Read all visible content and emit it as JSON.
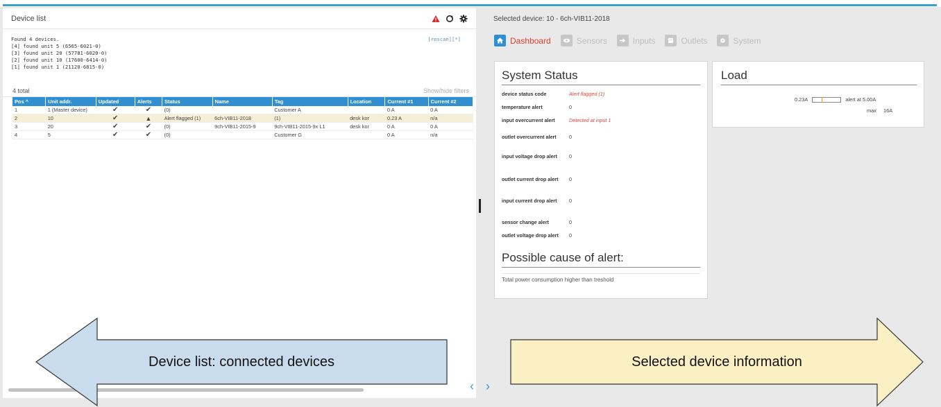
{
  "colors": {
    "accent_blue": "#2f8fd0",
    "alert_red": "#e0443a",
    "highlight_row": "#f6efd8",
    "arrow_left_fill": "#c9dced",
    "arrow_right_fill": "#fbefc4"
  },
  "left_panel": {
    "title": "Device list",
    "icons": [
      "alert-icon",
      "refresh-icon",
      "settings-icon"
    ],
    "console_lines": [
      "Found 4 devices.",
      "[4] found unit 5 (6565-6021-0)",
      "[3] found unit 20 (57781-6020-0)",
      "[2] found unit 10 (17600-6414-0)",
      "[1] found unit 1 (21120-6815-0)"
    ],
    "rescan_label": "[rescan][*]",
    "total_label": "4 total",
    "filters_label": "Show/hide filters",
    "table": {
      "columns": [
        "Pos ^",
        "Unit addr.",
        "Updated",
        "Alerts",
        "Status",
        "Name",
        "Tag",
        "Location",
        "Current #1",
        "Current #2"
      ],
      "rows": [
        {
          "pos": "1",
          "unit": "1 (Master device)",
          "updated": "✔",
          "alert": "✔",
          "status": "(0)",
          "name": "",
          "tag": "Customer A",
          "location": "",
          "c1": "0 A",
          "c2": "0 A"
        },
        {
          "pos": "2",
          "unit": "10",
          "updated": "✔",
          "alert": "▲",
          "status": "Alert flagged (1)",
          "name": "6ch-VIB11-2018",
          "tag": "(1)",
          "location": "desk kor",
          "c1": "0.23 A",
          "c2": "n/a"
        },
        {
          "pos": "3",
          "unit": "20",
          "updated": "✔",
          "alert": "✔",
          "status": "(0)",
          "name": "9ch-VIB11-2015-9",
          "tag": "9ch-VIB11-2015-9x L1",
          "location": "desk kor",
          "c1": "0 A",
          "c2": "0 A"
        },
        {
          "pos": "4",
          "unit": "5",
          "updated": "✔",
          "alert": "✔",
          "status": "(0)",
          "name": "",
          "tag": "Customer G",
          "location": "",
          "c1": "0 A",
          "c2": "n/a"
        }
      ]
    }
  },
  "nav_arrows": "‹ ›",
  "right_panel": {
    "selected_label": "Selected device: 10 - 6ch-VIB11-2018",
    "tabs": [
      {
        "label": "Dashboard",
        "icon": "home-icon",
        "active": true
      },
      {
        "label": "Sensors",
        "icon": "eye-icon",
        "active": false
      },
      {
        "label": "Inputs",
        "icon": "sign-in-icon",
        "active": false
      },
      {
        "label": "Outlets",
        "icon": "outlet-icon",
        "active": false
      },
      {
        "label": "System",
        "icon": "gear-icon",
        "active": false
      }
    ],
    "status": {
      "title": "System Status",
      "rows": [
        {
          "key": "device status code",
          "value": "Alert flagged (1)",
          "warn": true
        },
        {
          "key": "temperature alert",
          "value": "0",
          "warn": false
        },
        {
          "key": "input overcurrent alert",
          "value": "Detected at input 1",
          "warn": true
        },
        {
          "key": "outlet overcurrent alert",
          "value": "0",
          "warn": false
        },
        {
          "key": "input voltage drop alert",
          "value": "0",
          "warn": false
        },
        {
          "key": "outlet current drop alert",
          "value": "0",
          "warn": false
        },
        {
          "key": "input current drop alert",
          "value": "0",
          "warn": false
        },
        {
          "key": "sensor change alert",
          "value": "0",
          "warn": false
        },
        {
          "key": "outlet voltage drop alert",
          "value": "0",
          "warn": false
        }
      ],
      "cause_title": "Possible cause of alert:",
      "cause_text": "Total power consumption higher than treshold"
    },
    "load": {
      "title": "Load",
      "current": "0.23A",
      "current_fraction": 0.014,
      "alert_mark_fraction": 0.31,
      "alert_label": "alert at 5.00A",
      "max_label": "max",
      "max_value": "16A"
    }
  },
  "callouts": {
    "left": "Device list: connected devices",
    "right": "Selected device information"
  }
}
